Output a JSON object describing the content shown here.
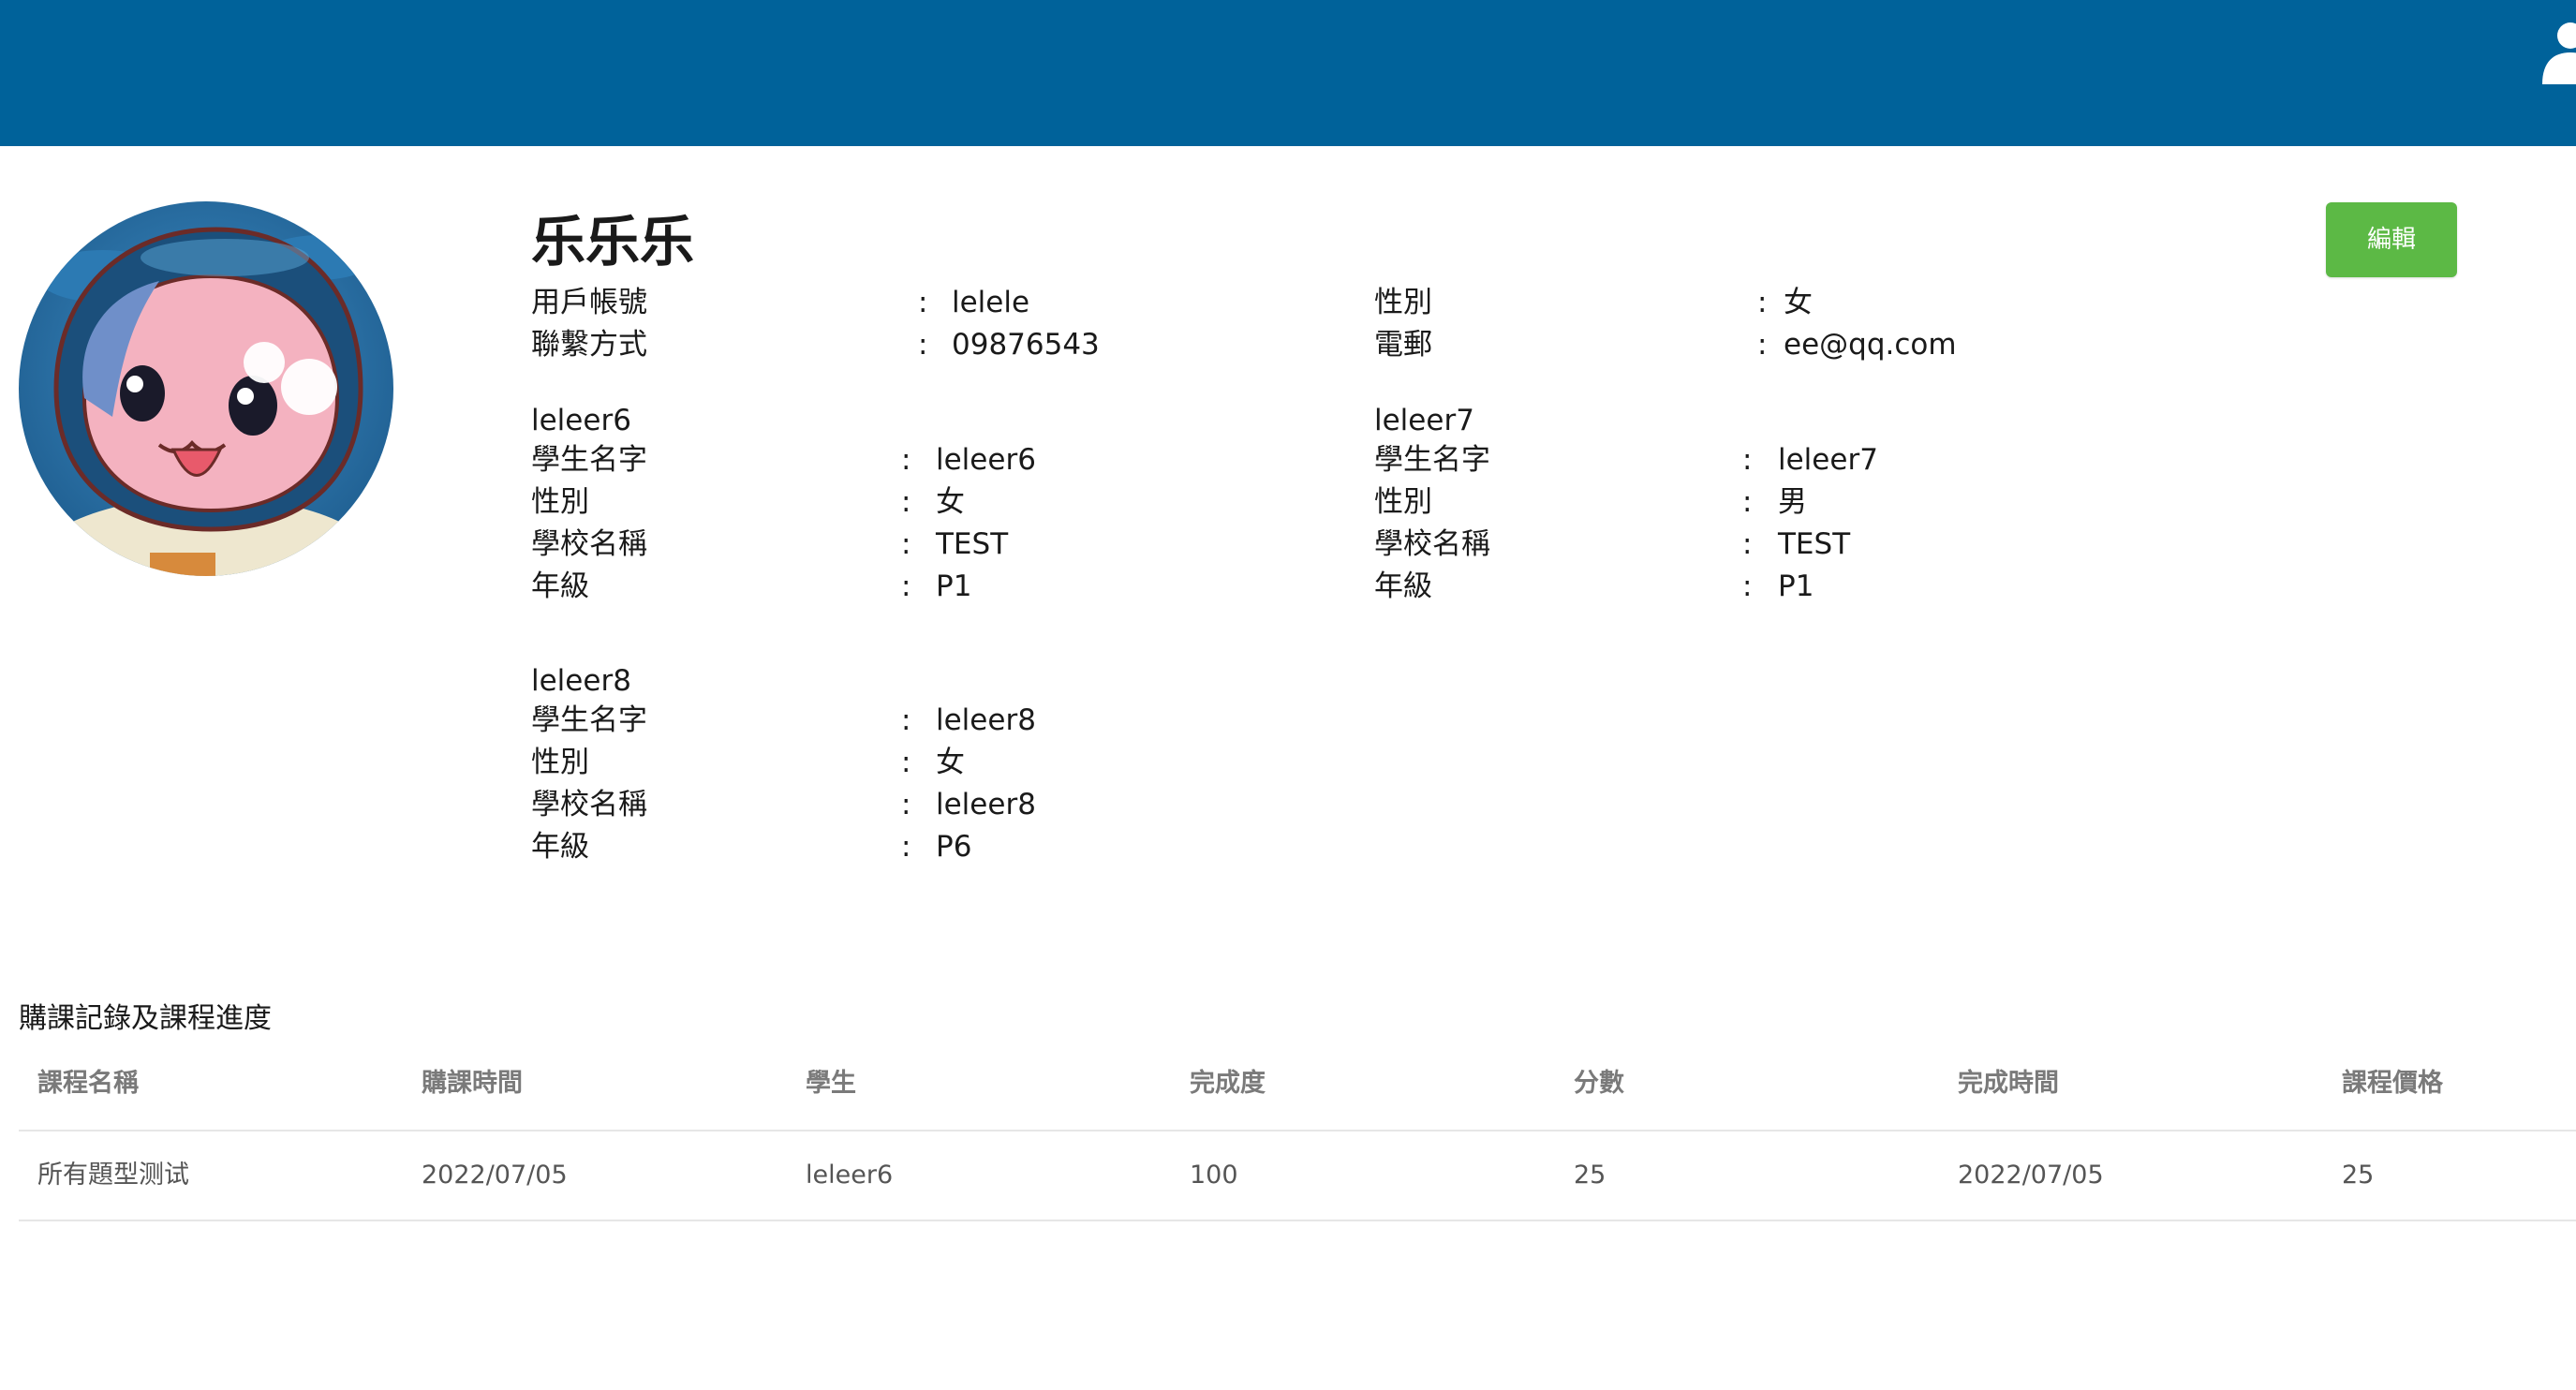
{
  "header": {
    "user_icon": "user-icon",
    "color": "#00629a"
  },
  "profile": {
    "name": "乐乐乐",
    "edit_label": "編輯",
    "fields": {
      "account_label": "用戶帳號",
      "account_value": "lelele",
      "gender_label": "性別",
      "gender_value": "女",
      "contact_label": "聯繫方式",
      "contact_value": "09876543",
      "email_label": "電郵",
      "email_value": "ee@qq.com"
    },
    "separator": ":"
  },
  "students": [
    {
      "heading": "leleer6",
      "name_label": "學生名字",
      "name": "leleer6",
      "gender_label": "性別",
      "gender": "女",
      "school_label": "學校名稱",
      "school": "TEST",
      "grade_label": "年級",
      "grade": "P1"
    },
    {
      "heading": "leleer7",
      "name_label": "學生名字",
      "name": "leleer7",
      "gender_label": "性別",
      "gender": "男",
      "school_label": "學校名稱",
      "school": "TEST",
      "grade_label": "年級",
      "grade": "P1"
    },
    {
      "heading": "leleer8",
      "name_label": "學生名字",
      "name": "leleer8",
      "gender_label": "性別",
      "gender": "女",
      "school_label": "學校名稱",
      "school": "leleer8",
      "grade_label": "年級",
      "grade": "P6"
    }
  ],
  "records": {
    "title": "購課記錄及課程進度",
    "columns": [
      "課程名稱",
      "購課時間",
      "學生",
      "完成度",
      "分數",
      "完成時間",
      "課程價格"
    ],
    "rows": [
      [
        "所有題型测试",
        "2022/07/05",
        "leleer6",
        "100",
        "25",
        "2022/07/05",
        "25"
      ]
    ]
  },
  "colors": {
    "edit_button": "#5cb945",
    "header": "#00629a"
  }
}
